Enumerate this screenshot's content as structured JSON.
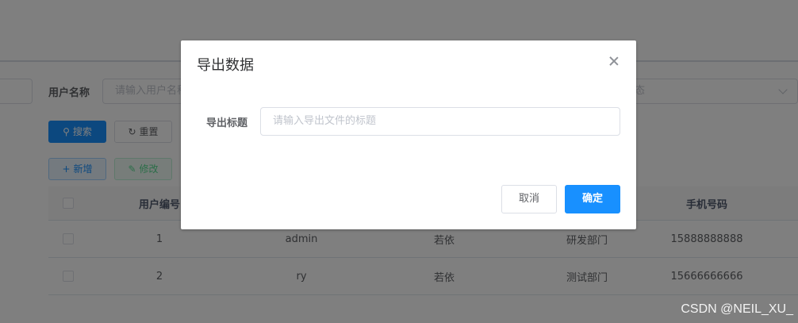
{
  "search_form": {
    "username_label": "用户名称",
    "username_placeholder": "请输入用户名称",
    "status_placeholder": "用户状态"
  },
  "toolbar": {
    "search_label": "搜索",
    "reset_label": "重置",
    "add_label": "新增",
    "edit_label": "修改"
  },
  "table": {
    "headers": {
      "user_id": "用户编号",
      "phone": "手机号码"
    },
    "rows": [
      {
        "user_id": "1",
        "user_name": "admin",
        "nick_name": "若依",
        "dept": "研发部门",
        "phone": "15888888888"
      },
      {
        "user_id": "2",
        "user_name": "ry",
        "nick_name": "若依",
        "dept": "测试部门",
        "phone": "15666666666"
      }
    ]
  },
  "dialog": {
    "title": "导出数据",
    "field_label": "导出标题",
    "field_placeholder": "请输入导出文件的标题",
    "cancel_label": "取消",
    "confirm_label": "确定"
  },
  "watermark": "CSDN @NEIL_XU_"
}
